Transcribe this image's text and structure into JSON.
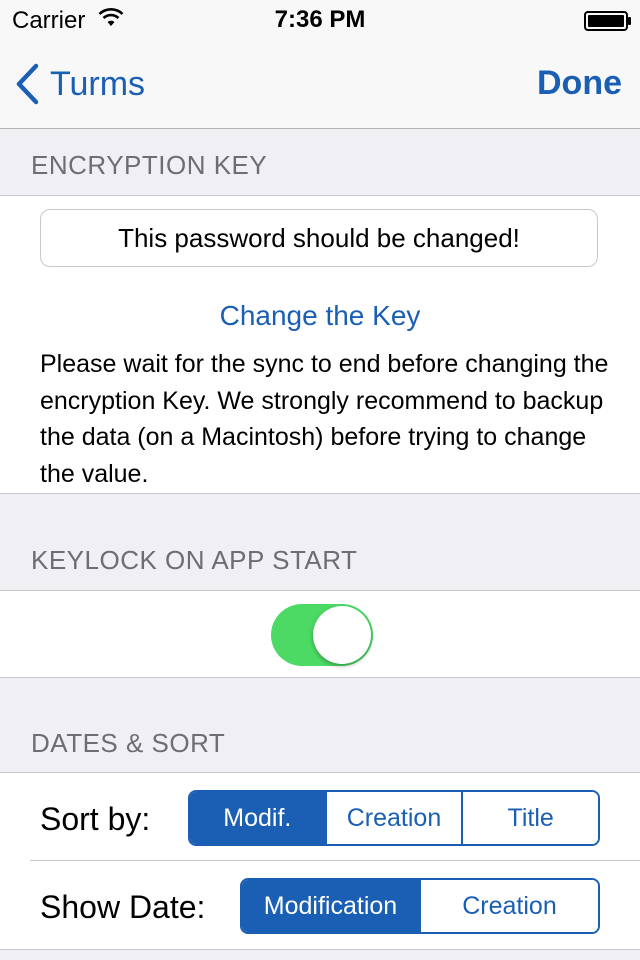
{
  "status_bar": {
    "carrier": "Carrier",
    "time": "7:36 PM",
    "wifi_icon": "wifi-icon",
    "battery_icon": "battery-icon"
  },
  "nav": {
    "back_label": "Turms",
    "done_label": "Done",
    "back_icon": "chevron-left-icon"
  },
  "encryption": {
    "header": "ENCRYPTION KEY",
    "password_value": "This password should be changed!",
    "change_key_label": "Change the Key",
    "help_text": "Please wait for the sync to end before changing the encryption Key. We strongly recommend to backup the data (on a Macintosh) before trying to change the value."
  },
  "keylock": {
    "header": "KEYLOCK ON APP START",
    "enabled": true
  },
  "dates_sort": {
    "header": "DATES & SORT",
    "sort_by_label": "Sort by:",
    "sort_options": [
      "Modif.",
      "Creation",
      "Title"
    ],
    "sort_selected": "Modif.",
    "show_date_label": "Show Date:",
    "date_options": [
      "Modification",
      "Creation"
    ],
    "date_selected": "Modification"
  },
  "colors": {
    "accent": "#1a5fb4",
    "toggle_on": "#4cd964",
    "background": "#efeff4",
    "section_header": "#6d6d72"
  }
}
